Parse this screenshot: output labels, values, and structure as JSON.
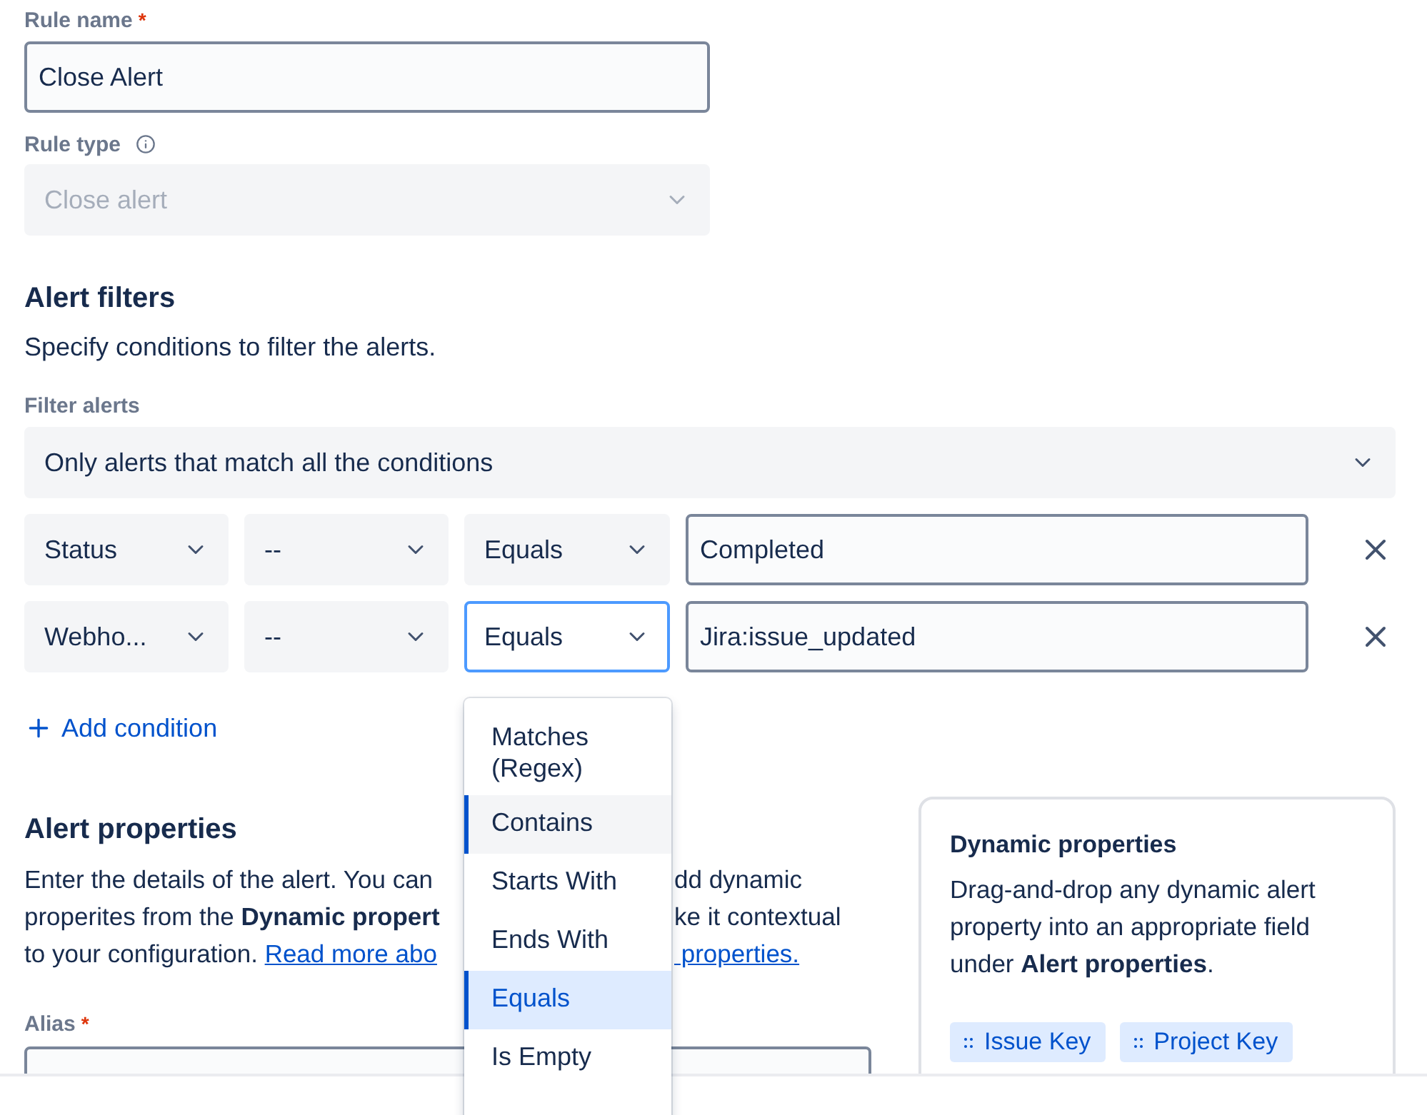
{
  "rule_name": {
    "label": "Rule name",
    "required_mark": "*",
    "value": "Close Alert"
  },
  "rule_type": {
    "label": "Rule type",
    "value": "Close alert",
    "disabled": true
  },
  "alert_filters": {
    "heading": "Alert filters",
    "description": "Specify conditions to filter the alerts.",
    "filter_label": "Filter alerts",
    "filter_value": "Only alerts that match all the conditions",
    "conditions": [
      {
        "field": "Status",
        "operator_1": "--",
        "operator_2": "Equals",
        "operator_2_focused": false,
        "value": "Completed"
      },
      {
        "field": "Webho...",
        "operator_1": "--",
        "operator_2": "Equals",
        "operator_2_focused": true,
        "value": "Jira:issue_updated"
      }
    ],
    "add_condition": "Add condition"
  },
  "operator_menu": {
    "items": [
      {
        "label": "Matches (Regex)",
        "selected": false,
        "hovered": false
      },
      {
        "label": "Contains",
        "selected": false,
        "hovered": true
      },
      {
        "label": "Starts With",
        "selected": false,
        "hovered": false
      },
      {
        "label": "Ends With",
        "selected": false,
        "hovered": false
      },
      {
        "label": "Equals",
        "selected": true,
        "hovered": false
      },
      {
        "label": "Is Empty",
        "selected": false,
        "hovered": false
      }
    ]
  },
  "alert_properties": {
    "heading": "Alert properties",
    "description_lines": [
      {
        "left": "Enter the details of the alert. You can",
        "right": "dd dynamic"
      },
      {
        "left": "properites from the **Dynamic propert**",
        "right": "ke it contextual"
      },
      {
        "left": "to your configuration.",
        "left_link": "Read more abo",
        "right_link": " properties."
      }
    ],
    "alias": {
      "label": "Alias",
      "required_mark": "*"
    }
  },
  "dynamic_card": {
    "title": "Dynamic properties",
    "text": "Drag-and-drop any dynamic alert property into an appropriate field under **Alert properties**.",
    "chips": [
      "Issue Key",
      "Project Key"
    ]
  }
}
